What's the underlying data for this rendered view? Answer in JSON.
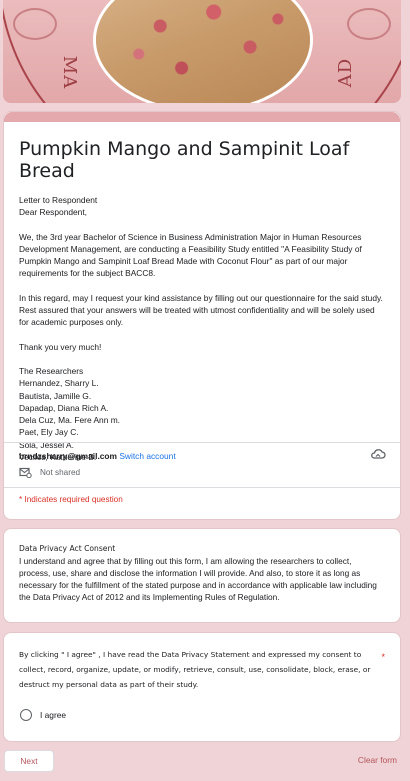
{
  "banner": {
    "left_text": "MA",
    "right_text": "AD"
  },
  "form": {
    "title": "Pumpkin Mango and Sampinit Loaf Bread",
    "description": [
      "Letter to Respondent\nDear Respondent,",
      "We, the 3rd year Bachelor of Science in Business Administration Major in Human Resources Development Management, are conducting a Feasibility Study entitled \"A Feasibility Study of Pumpkin Mango and Sampinit Loaf Bread Made with Coconut Flour\" as part of our major requirements for the subject BACC8.",
      "In this regard, may I request your kind assistance by filling out our questionnaire for the said study. Rest assured that your answers will be treated with utmost confidentiality and will be solely used for academic purposes only.",
      "Thank you very much!",
      "The Researchers\nHernandez, Sharry L.\nBautista, Jamille G.\nDapadap, Diana Rich A.\nDela Cuz, Ma. Fere Ann m.\nPaet, Ely Jay C.\nSola, Jessel A.\nVecilos, Katherine B."
    ],
    "account_email": "hrndzsharry@gmail.com",
    "switch_account": "Switch account",
    "not_shared": "Not shared",
    "required_note": "* Indicates required question"
  },
  "privacy": {
    "title": "Data Privacy Act Consent",
    "body": "I understand and agree that by filling out this form, I am allowing the researchers to collect, process, use, share and disclose the information I will provide. And also, to store it as long as necessary for the fulfillment of the stated purpose and in accordance with applicable law including the Data Privacy Act of 2012 and its Implementing Rules of Regulation."
  },
  "consent": {
    "question": "By clicking \" I agree\" , I have read the Data Privacy Statement and expressed my consent to collect, record, organize, update, or modify, retrieve, consult, use, consolidate, block, erase, or destruct my personal data as part of their study.",
    "required_star": "*",
    "option": "I agree"
  },
  "footer": {
    "next": "Next",
    "clear": "Clear form"
  },
  "colors": {
    "accent": "#b2565c",
    "required": "#d93025",
    "background": "#f0d3d6"
  }
}
